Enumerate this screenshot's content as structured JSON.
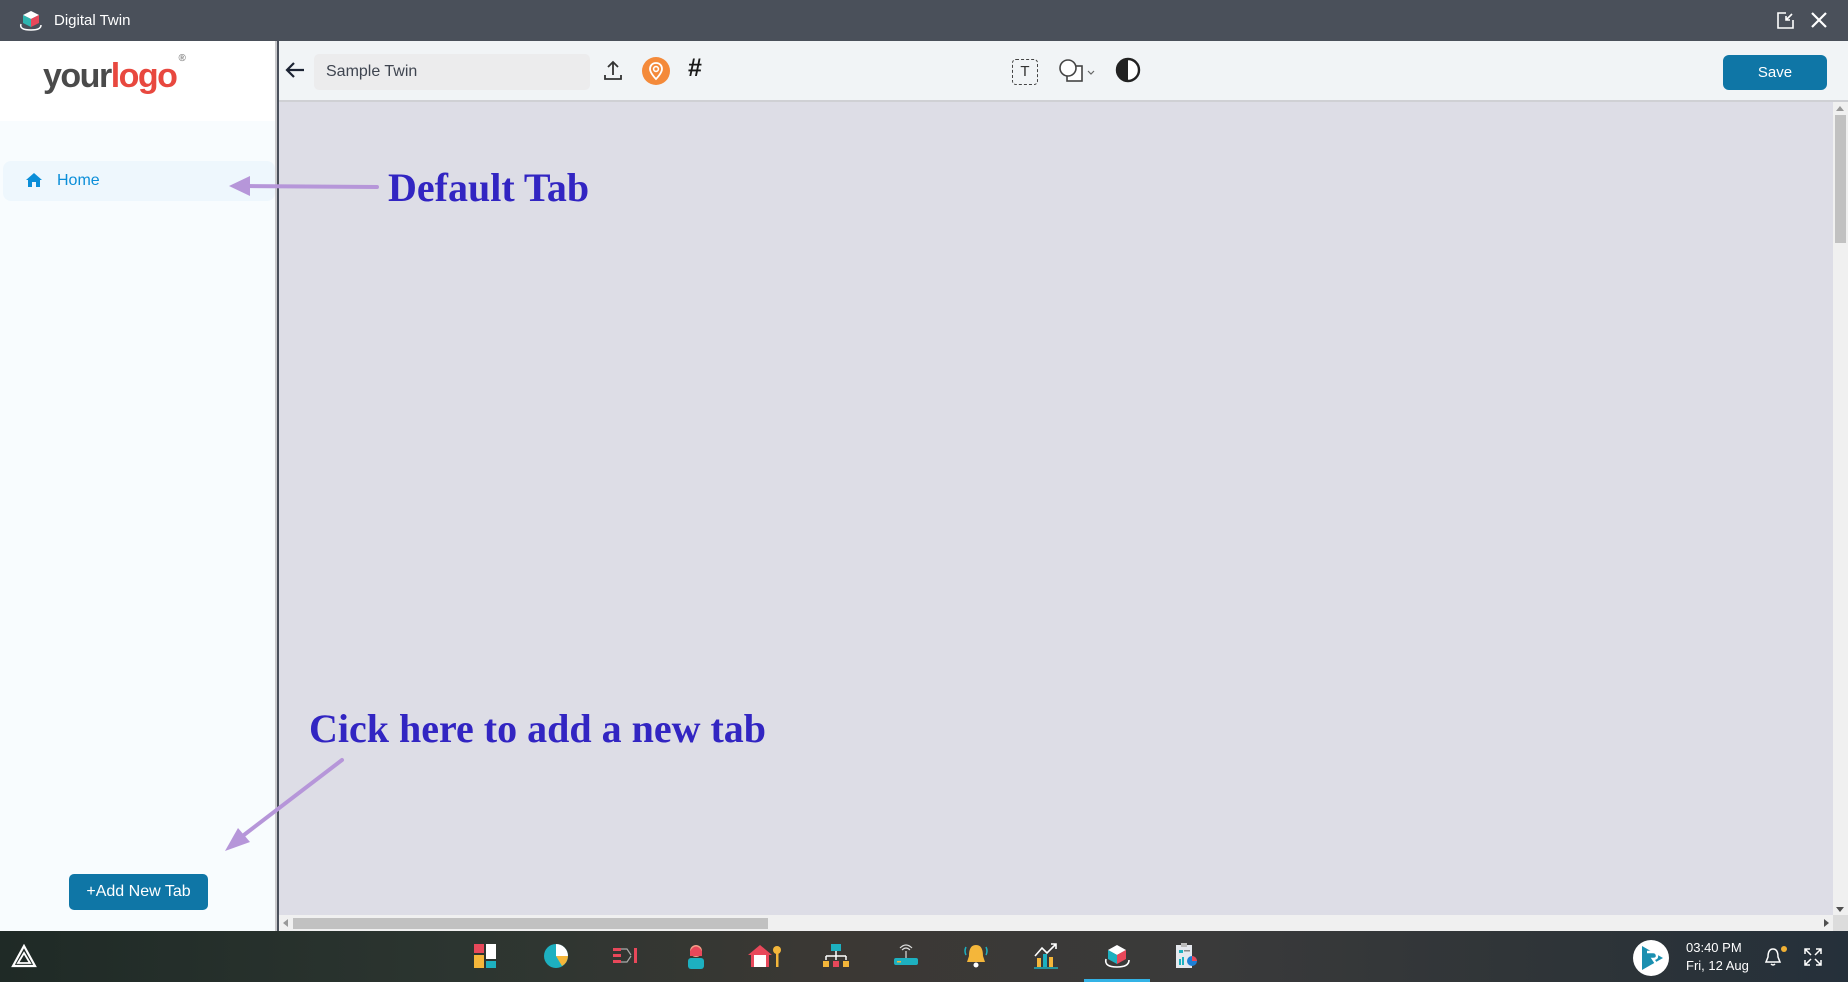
{
  "window": {
    "title": "Digital Twin",
    "app_icon": "cube-rotate-icon",
    "controls": [
      "popout-icon",
      "close-icon"
    ]
  },
  "sidebar": {
    "logo": {
      "part1": "your",
      "part2": "logo",
      "mark": "®"
    },
    "tabs": [
      {
        "label": "Home",
        "icon": "home-icon",
        "active": true
      }
    ],
    "add_tab_label": "+Add New Tab"
  },
  "toolbar": {
    "back_icon": "arrow-left-icon",
    "twin_name_value": "Sample Twin",
    "tools": [
      "upload-icon",
      "location-pin-icon",
      "hash-icon",
      "text-tool-icon",
      "shapes-icon",
      "contrast-icon"
    ],
    "hash_glyph": "#",
    "text_tool_glyph": "T",
    "save_label": "Save"
  },
  "annotations": {
    "default_tab": "Default Tab",
    "add_tab_hint": "Cick here to add a new tab",
    "arrow_color": "#b696d9",
    "text_color": "#3225c2"
  },
  "taskbar": {
    "apps": [
      "dashboard-icon",
      "pie-chart-icon",
      "flow-icon",
      "user-icon",
      "home-key-icon",
      "hierarchy-icon",
      "router-icon",
      "bell-alert-icon",
      "analytics-icon",
      "digital-twin-icon",
      "report-icon"
    ],
    "active_app": "digital-twin-icon",
    "time": "03:40 PM",
    "date": "Fri, 12 Aug"
  },
  "colors": {
    "primary": "#0f76a6",
    "home_text": "#0b8ed8",
    "canvas": "#dddde6",
    "titlebar": "#4a505a"
  }
}
